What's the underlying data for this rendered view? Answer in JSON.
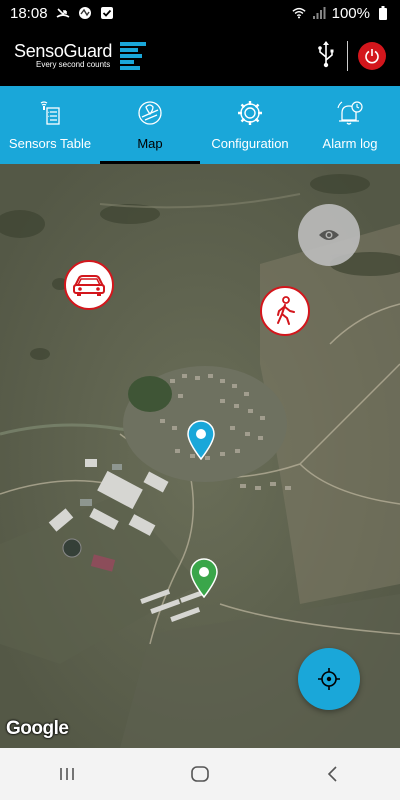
{
  "status_bar": {
    "time": "18:08",
    "battery": "100%"
  },
  "header": {
    "brand": "SensoGuard",
    "tagline": "Every second counts"
  },
  "tabs": [
    {
      "label": "Sensors Table",
      "icon": "sensors-table-icon",
      "active": false
    },
    {
      "label": "Map",
      "icon": "map-icon",
      "active": true
    },
    {
      "label": "Configuration",
      "icon": "gear-icon",
      "active": false
    },
    {
      "label": "Alarm log",
      "icon": "alarm-clock-icon",
      "active": false
    }
  ],
  "map": {
    "attribution": "Google",
    "markers": [
      {
        "type": "vehicle-alert",
        "color": "#d3161c"
      },
      {
        "type": "person-alert",
        "color": "#d3161c"
      },
      {
        "type": "sensor-pin",
        "color": "#1aa7d9"
      },
      {
        "type": "sensor-pin",
        "color": "#3aa64a"
      }
    ]
  },
  "colors": {
    "accent": "#1aa7d9",
    "alert": "#d3161c",
    "ok": "#3aa64a"
  }
}
